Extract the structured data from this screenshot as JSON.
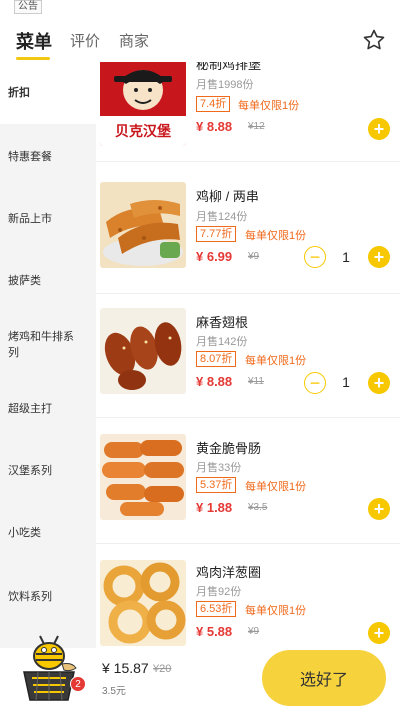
{
  "notice": "公告",
  "tabs": [
    {
      "label": "菜单",
      "active": true
    },
    {
      "label": "评价",
      "active": false
    },
    {
      "label": "商家",
      "active": false
    }
  ],
  "sidebar": {
    "items": [
      {
        "label": "折扣",
        "active": true
      },
      {
        "label": "特惠套餐",
        "active": false
      },
      {
        "label": "新品上市",
        "active": false
      },
      {
        "label": "披萨类",
        "active": false
      },
      {
        "label": "烤鸡和牛排系列",
        "active": false
      },
      {
        "label": "超级主打",
        "active": false
      },
      {
        "label": "汉堡系列",
        "active": false
      },
      {
        "label": "小吃类",
        "active": false
      },
      {
        "label": "饮料系列",
        "active": false
      }
    ]
  },
  "products": [
    {
      "name": "秘制鸡排堡",
      "sold": "月售1998份",
      "discount": "7.4折",
      "limit": "每单仅限1份",
      "price": "¥ 8.88",
      "original": "¥12",
      "quantity": null,
      "image": "burger-logo"
    },
    {
      "name": "鸡柳 / 两串",
      "sold": "月售124份",
      "discount": "7.77折",
      "limit": "每单仅限1份",
      "price": "¥ 6.99",
      "original": "¥9",
      "quantity": "1",
      "image": "chicken-strips"
    },
    {
      "name": "麻香翅根",
      "sold": "月售142份",
      "discount": "8.07折",
      "limit": "每单仅限1份",
      "price": "¥ 8.88",
      "original": "¥11",
      "quantity": "1",
      "image": "wing-roots"
    },
    {
      "name": "黄金脆骨肠",
      "sold": "月售33份",
      "discount": "5.37折",
      "limit": "每单仅限1份",
      "price": "¥ 1.88",
      "original": "¥3.5",
      "quantity": null,
      "image": "sausages"
    },
    {
      "name": "鸡肉洋葱圈",
      "sold": "月售92份",
      "discount": "6.53折",
      "limit": "每单仅限1份",
      "price": "¥ 5.88",
      "original": "¥9",
      "quantity": null,
      "image": "onion-rings"
    }
  ],
  "logo_text": "贝克汉堡",
  "cart": {
    "badge": "2",
    "total": "¥ 15.87",
    "original_total": "¥20",
    "delivery": "3.5元",
    "checkout_label": "选好了"
  },
  "colors": {
    "accent": "#f7c800",
    "price": "#e53935",
    "discount": "#f06a1c"
  }
}
